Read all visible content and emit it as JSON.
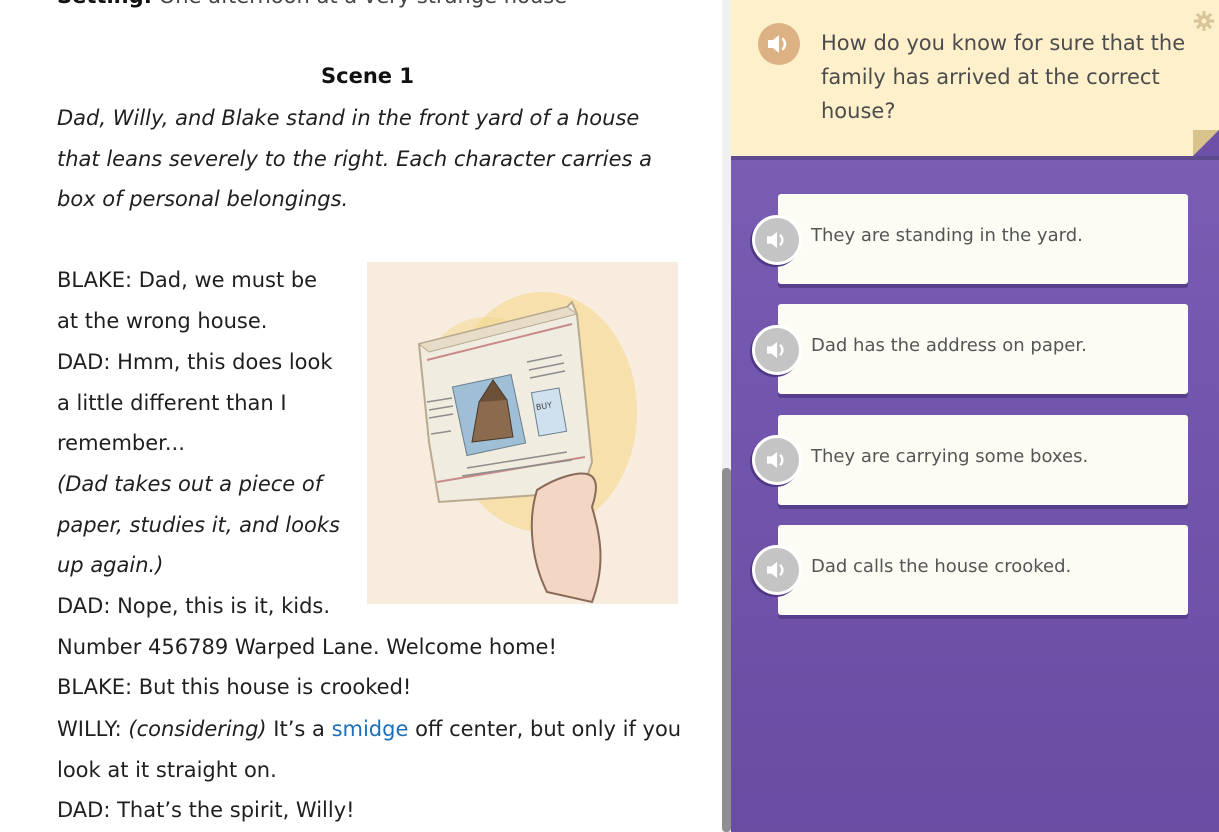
{
  "reading": {
    "setting_label": "Setting:",
    "setting_text": "One afternoon at a very strange house",
    "scene_title": "Scene 1",
    "stage_direction_lines": [
      "Dad, Willy, and Blake stand in the front yard of a house",
      "that leans severely to the right. Each character carries a",
      "box of personal belongings."
    ],
    "lines": [
      "BLAKE: Dad, we must be",
      "at the wrong house.",
      "DAD: Hmm, this does look",
      "a little different than I",
      "remember...",
      "(Dad takes out a piece of",
      "paper, studies it, and looks",
      "up again.)",
      "DAD: Nope, this is it, kids.",
      "Number 456789 Warped Lane. Welcome home!",
      "BLAKE: But this house is crooked!",
      "",
      "look at it straight on.",
      "DAD: That’s the spirit, Willy!"
    ],
    "willy_line": {
      "speaker": "WILLY:",
      "aside": "(considering)",
      "before": "It’s a",
      "glossary_word": "smidge",
      "after": "off center, but only if you"
    },
    "illustration": {
      "paper_label": "BUY",
      "alt": "A hand holding up a newspaper with a picture of a crooked house"
    }
  },
  "question": {
    "text": "How do you know for sure that the family has arrived at the correct house?",
    "audio_icon": "speaker-icon",
    "settings_icon": "gear-icon"
  },
  "answers": [
    {
      "label": "They are standing in the yard."
    },
    {
      "label": "Dad has the address on paper."
    },
    {
      "label": "They are carrying some boxes."
    },
    {
      "label": "Dad calls the house crooked."
    }
  ],
  "colors": {
    "panel_purple": "#7356ad",
    "question_card": "#fdf0cb",
    "question_audio": "#dcb184",
    "answer_card": "#fdfcf4",
    "glossary_link": "#1d6fb8"
  }
}
